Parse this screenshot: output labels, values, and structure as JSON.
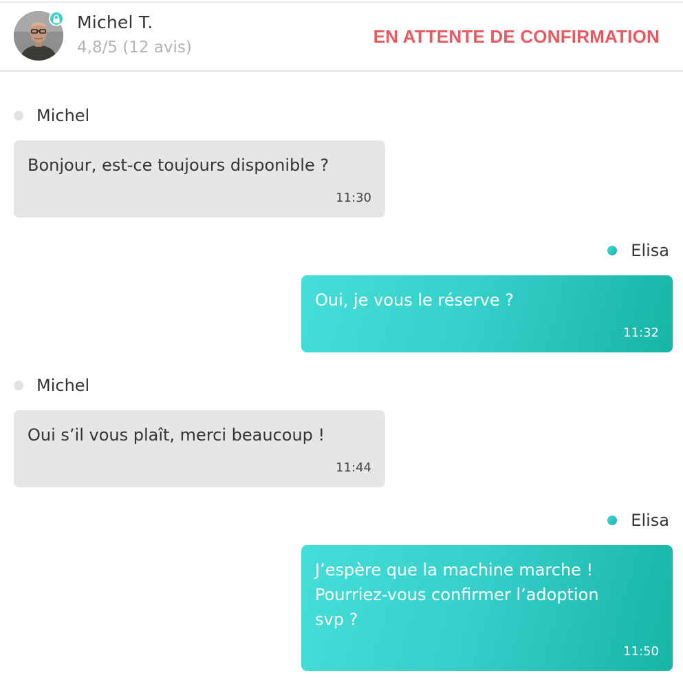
{
  "header": {
    "user_name": "Michel T.",
    "rating": "4,8/5 (12 avis)",
    "status": "EN ATTENTE DE CONFIRMATION",
    "avatar_icon": "user-photo",
    "badge_icon": "lock-icon"
  },
  "colors": {
    "accent": "#36d0cb",
    "accent_dark": "#17b4a7",
    "status": "#eb5960",
    "incoming_bubble": "#e6e6e6"
  },
  "messages": [
    {
      "sender": "Michel",
      "direction": "incoming",
      "text": "Bonjour, est-ce toujours disponible ?",
      "time": "11:30"
    },
    {
      "sender": "Elisa",
      "direction": "outgoing",
      "text": "Oui, je vous le réserve ?",
      "time": "11:32"
    },
    {
      "sender": "Michel",
      "direction": "incoming",
      "text": "Oui s’il vous plaît, merci beaucoup !",
      "time": "11:44"
    },
    {
      "sender": "Elisa",
      "direction": "outgoing",
      "text": "J’espère que la machine marche ! Pourriez-vous confirmer l’adoption svp ?",
      "time": "11:50"
    }
  ]
}
